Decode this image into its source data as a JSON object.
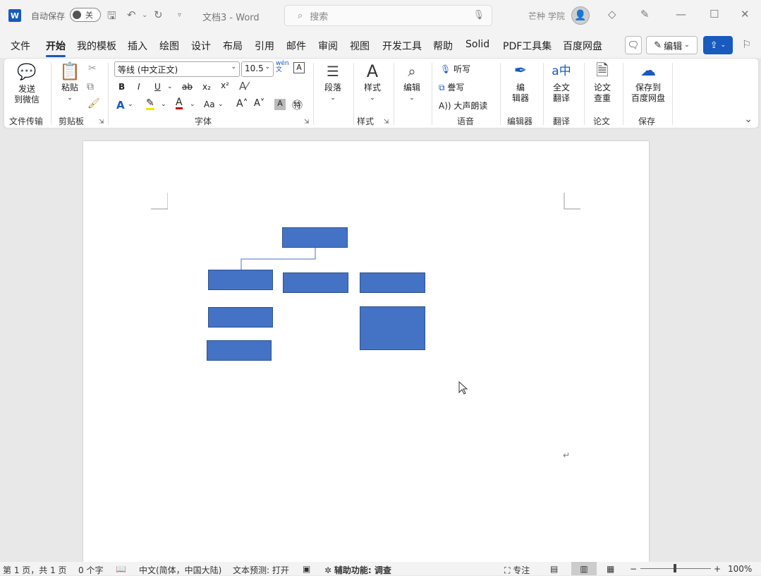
{
  "titlebar": {
    "autosave_label": "自动保存",
    "autosave_state": "关",
    "doc_title": "文档3 - Word",
    "search_placeholder": "搜索",
    "user_name": "芒种 学院"
  },
  "tabs": [
    "文件",
    "开始",
    "我的模板",
    "插入",
    "绘图",
    "设计",
    "布局",
    "引用",
    "邮件",
    "审阅",
    "视图",
    "开发工具",
    "帮助",
    "Solid",
    "PDF工具集",
    "百度网盘"
  ],
  "active_tab": "开始",
  "menubar": {
    "edit_label": "编辑"
  },
  "ribbon": {
    "send_wechat": "发送\n到微信",
    "group_file_transfer": "文件传输",
    "paste": "粘贴",
    "group_clipboard": "剪贴板",
    "font_name": "等线 (中文正文)",
    "font_size": "10.5",
    "group_font": "字体",
    "paragraph": "段落",
    "styles": "样式",
    "group_styles": "样式",
    "editing": "编辑",
    "listen": "听写",
    "dictate": "誊写",
    "read_aloud": "大声朗读",
    "group_voice": "语音",
    "editor": "编\n辑器",
    "group_editor": "编辑器",
    "translate": "全文\n翻译",
    "group_translate": "翻译",
    "paper_check": "论文\n查重",
    "group_paper": "论文",
    "save_baidu": "保存到\n百度网盘",
    "group_save": "保存",
    "bold": "B",
    "italic": "I",
    "underline": "U",
    "strike": "ab",
    "subscript": "x₂",
    "superscript": "x²"
  },
  "status": {
    "page": "第 1 页，共 1 页",
    "words": "0 个字",
    "language": "中文(简体，中国大陆)",
    "prediction": "文本预测: 打开",
    "accessibility": "辅助功能: 调查",
    "focus": "专注",
    "zoom": "100%"
  },
  "colors": {
    "accent": "#185abd",
    "shape_fill": "#4472c4",
    "shape_border": "#2f528f"
  }
}
